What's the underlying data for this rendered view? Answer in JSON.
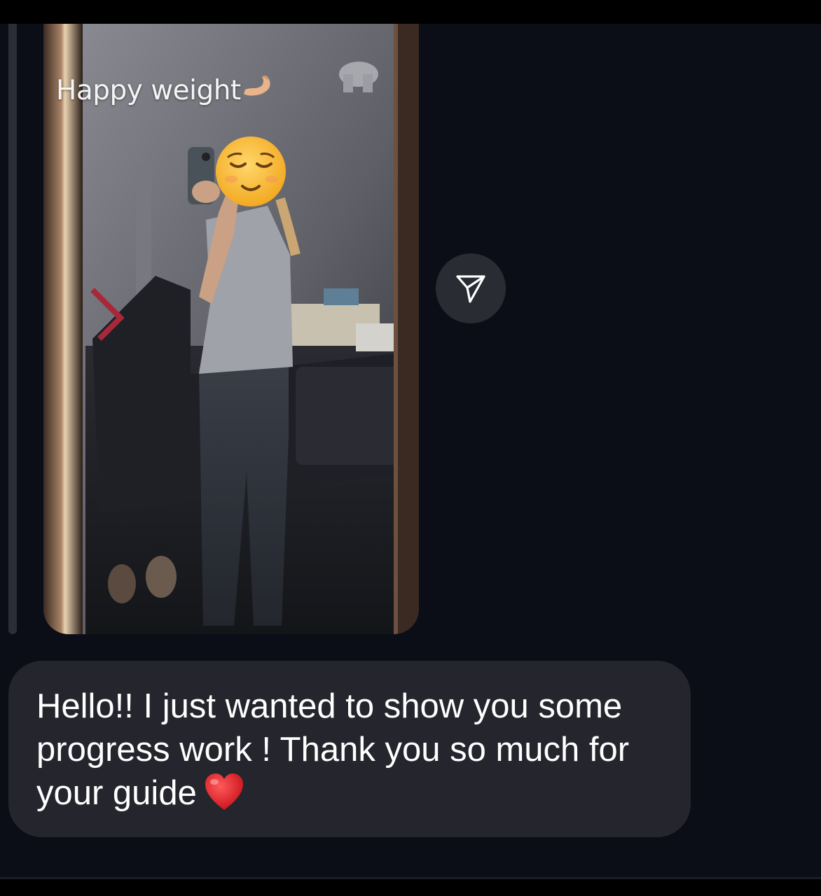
{
  "story_reply": {
    "caption": "Happy weight",
    "caption_emoji": "flexed-biceps-icon",
    "face_emoji": "relieved-face-icon"
  },
  "share_button": {
    "icon": "paper-plane-icon"
  },
  "message": {
    "text": "Hello!! I just wanted to show you some progress work ! Thank you so much for your guide",
    "trailing_emoji": "red-heart-icon"
  },
  "colors": {
    "background": "#0b0e17",
    "bubble": "#25262d",
    "share_button": "#2a2c34",
    "text": "#ffffff"
  }
}
